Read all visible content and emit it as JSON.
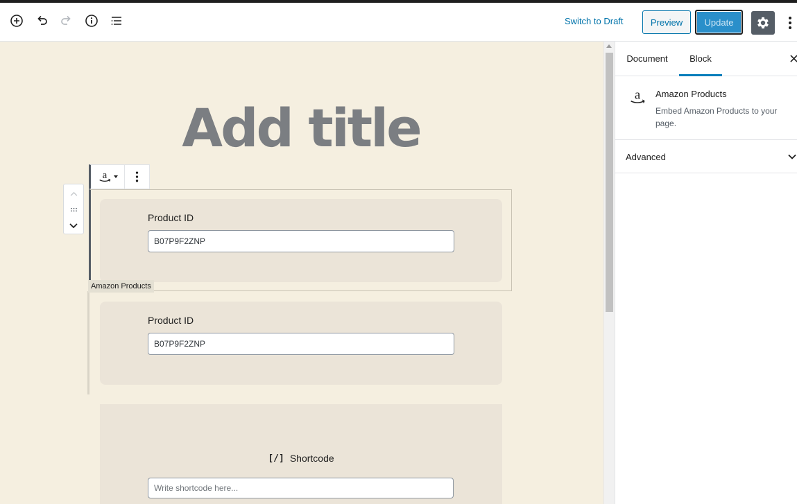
{
  "toolbar": {
    "switch_to_draft": "Switch to Draft",
    "preview": "Preview",
    "update": "Update",
    "icons": [
      "add-block-icon",
      "undo-icon",
      "redo-icon",
      "info-icon",
      "outline-icon",
      "gear-icon",
      "more-vertical-icon"
    ]
  },
  "editor": {
    "title_placeholder": "Add title",
    "block_label": "Amazon Products",
    "blocks": [
      {
        "label": "Product ID",
        "value": "B07P9F2ZNP"
      },
      {
        "label": "Product ID",
        "value": "B07P9F2ZNP"
      }
    ],
    "shortcode": {
      "label": "Shortcode",
      "icon": "[/]",
      "placeholder": "Write shortcode here..."
    }
  },
  "sidebar": {
    "tabs": [
      {
        "label": "Document",
        "active": false
      },
      {
        "label": "Block",
        "active": true
      }
    ],
    "block": {
      "title": "Amazon Products",
      "description": "Embed Amazon Products to your page."
    },
    "panel": {
      "title": "Advanced"
    }
  },
  "colors": {
    "accent": "#0073aa",
    "update_bg": "#2a8fca",
    "canvas_bg": "#f5efe0",
    "card_bg": "#ebe4d8",
    "tab_active": "#007cba"
  }
}
